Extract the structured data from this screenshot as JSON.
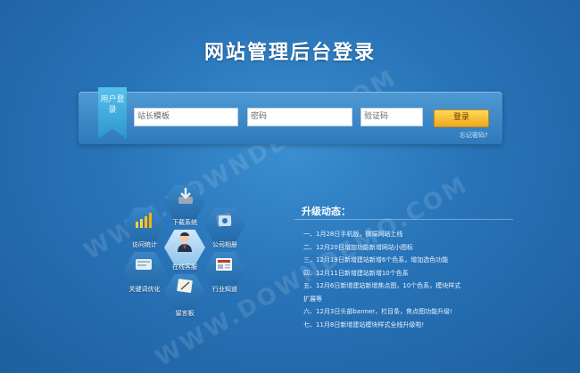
{
  "header": {
    "title": "网站管理后台登录"
  },
  "login": {
    "ribbon_label": "用户登录",
    "username_value": "站长模板",
    "password_placeholder": "密码",
    "captcha_placeholder": "验证码",
    "submit_label": "登录",
    "forgot_label": "忘记密码?"
  },
  "modules": {
    "download": "下载系统",
    "stats": "访问统计",
    "company": "公司相册",
    "support": "在线客服",
    "seo": "关键词优化",
    "industry": "行业知道",
    "guestbook": "留言板"
  },
  "news": {
    "title": "升级动态：",
    "items": [
      "一、1月28日手机版，微端网站上线",
      "二、12月20日增加功能新增网站小图标",
      "三、12月19日新增建站新增6个色系，增加选色功能",
      "四、12月11日新增建站新增10个色系",
      "五、12月6日新增建站新增焦点图，10个色系，模块样式",
      "扩展等",
      "六、12月3日头部banner，栏目条，焦点图功能升级!",
      "七、11月8日新增建站模块样式全线升级啦!"
    ]
  },
  "watermark": "WWW.DOWNDEMO.COM"
}
